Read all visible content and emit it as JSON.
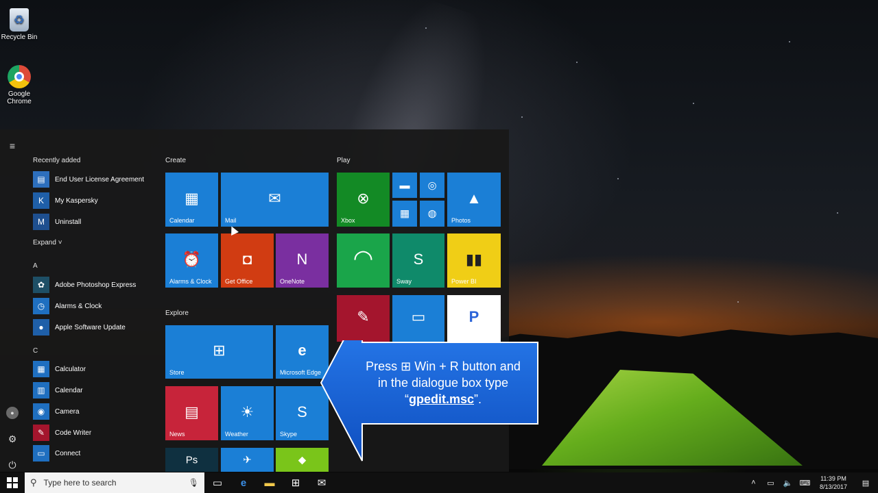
{
  "desktop": {
    "icons": [
      {
        "label": "Recycle Bin"
      },
      {
        "label": "Google\nChrome"
      }
    ]
  },
  "start_menu": {
    "recently_added_label": "Recently added",
    "recent": [
      {
        "label": "End User License Agreement",
        "color": "#2d6fbd"
      },
      {
        "label": "My Kaspersky",
        "color": "#1f5fa8"
      },
      {
        "label": "Uninstall",
        "color": "#1e4f8f"
      }
    ],
    "expand_label": "Expand",
    "letters": [
      "A",
      "C"
    ],
    "apps_a": [
      {
        "label": "Adobe Photoshop Express",
        "color": "#1e4f66"
      },
      {
        "label": "Alarms & Clock",
        "color": "#1f6fc0"
      },
      {
        "label": "Apple Software Update",
        "color": "#1f5fa8"
      }
    ],
    "apps_c": [
      {
        "label": "Calculator",
        "color": "#1f6fc0"
      },
      {
        "label": "Calendar",
        "color": "#1f6fc0"
      },
      {
        "label": "Camera",
        "color": "#1f6fc0"
      },
      {
        "label": "Code Writer",
        "color": "#a4152d"
      },
      {
        "label": "Connect",
        "color": "#1f6fc0"
      }
    ],
    "groups": {
      "create": "Create",
      "play": "Play",
      "explore": "Explore"
    },
    "tiles": {
      "calendar": "Calendar",
      "mail": "Mail",
      "alarms": "Alarms & Clock",
      "get_office": "Get Office",
      "onenote": "OneNote",
      "xbox": "Xbox",
      "photos": "Photos",
      "sway": "Sway",
      "powerbi": "Power BI",
      "store": "Store",
      "edge": "Microsoft Edge",
      "news": "News",
      "weather": "Weather",
      "skype": "Skype"
    }
  },
  "callout": {
    "line1": "Press ⊞ Win + R button and",
    "line2": "in the dialogue box type",
    "quote_open": "“",
    "command": "gpedit.msc",
    "quote_close": "”."
  },
  "taskbar": {
    "search_placeholder": "Type here to search",
    "time": "11:39 PM",
    "date": "8/13/2017"
  },
  "colors": {
    "tile_blue": "#1b7fd6",
    "office_red": "#d13c12",
    "onenote_purple": "#7a2fa0",
    "xbox_green": "#138a25",
    "sway_teal": "#0f8a6a",
    "powerbi_yellow": "#f0ce16",
    "news_red": "#c7243a",
    "callout_blue": "#1464d8"
  }
}
